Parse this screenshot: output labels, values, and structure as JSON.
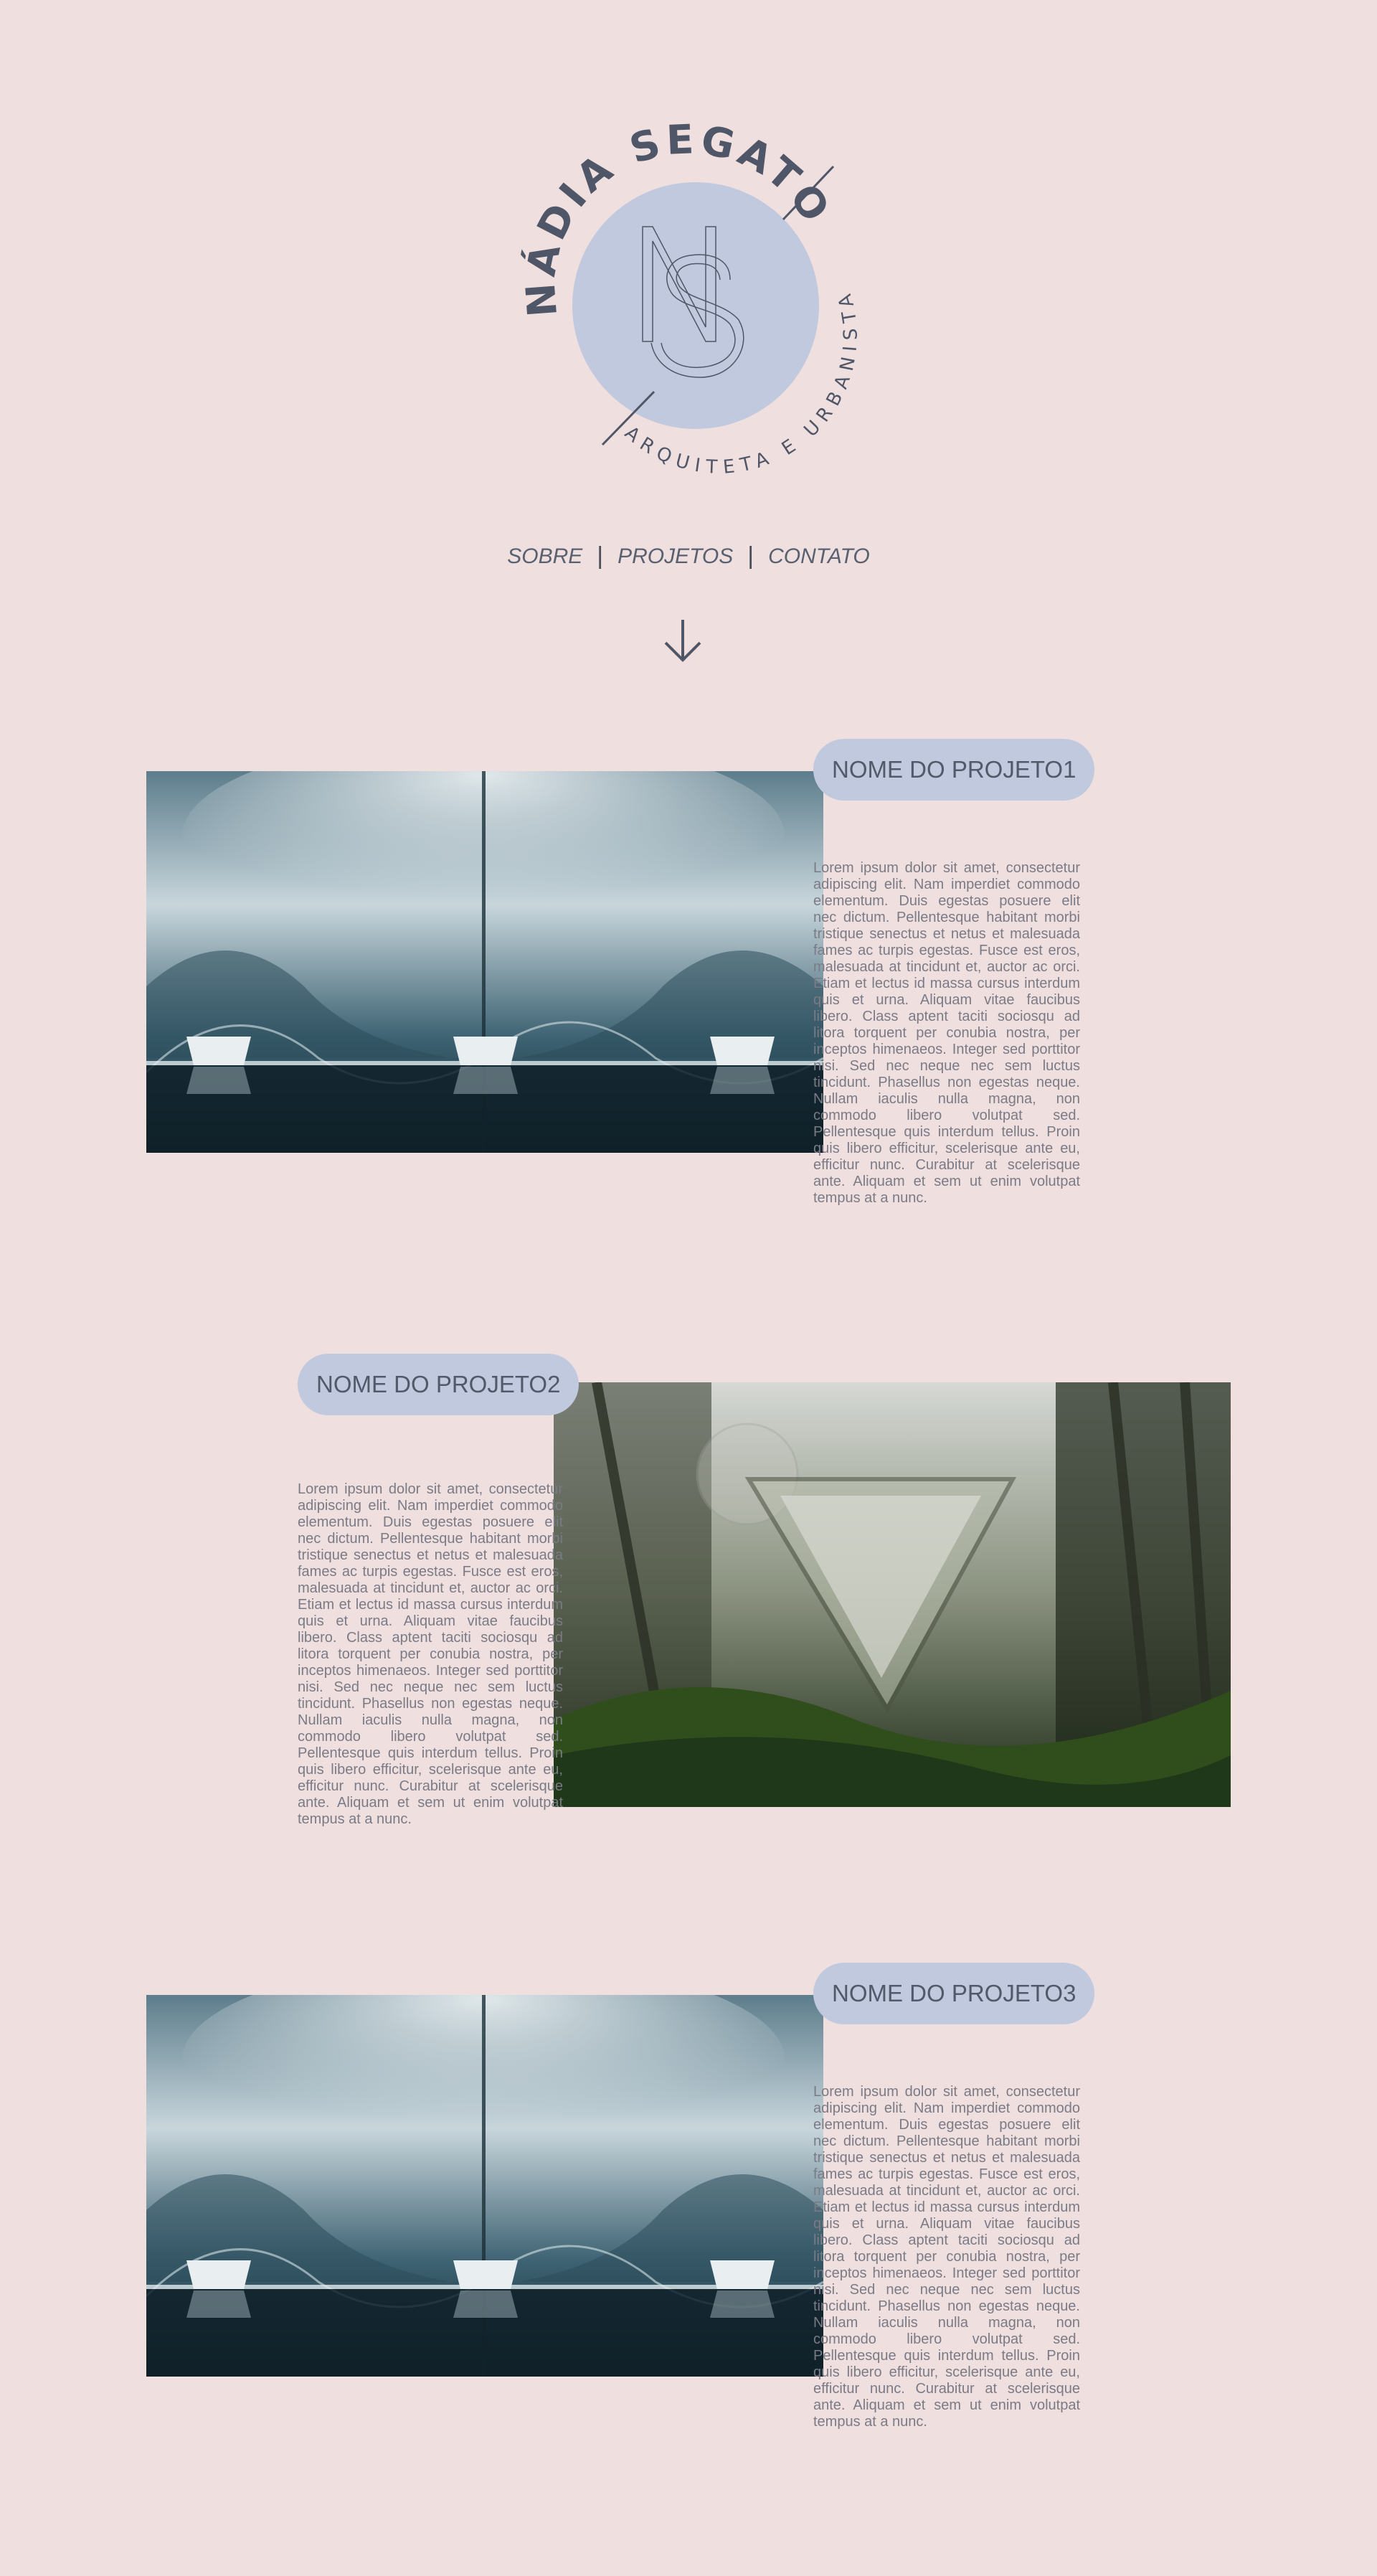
{
  "logo": {
    "name": "NÁDIA SEGATO",
    "subtitle": "ARQUITETA E URBANISTA",
    "monogram": "NS",
    "circle_color": "#c0c9dd",
    "text_color": "#4f5667"
  },
  "nav": {
    "items": [
      "SOBRE",
      "PROJETOS",
      "CONTATO"
    ],
    "separator": "|"
  },
  "scroll_icon": "arrow-down-icon",
  "projects": [
    {
      "title": "NOME DO PROJETO1",
      "image": "concrete-vault-architecture-photo",
      "description": "Lorem ipsum dolor sit amet, consectetur adipiscing elit. Nam imperdiet commodo elementum. Duis egestas posuere elit nec dictum. Pellentesque habitant morbi tristique senectus et netus et malesuada fames ac turpis egestas. Fusce est eros, malesuada at tincidunt et, auctor ac orci. Etiam et lectus id massa cursus interdum quis et urna. Aliquam vitae faucibus libero. Class aptent taciti sociosqu ad litora torquent per conubia nostra, per inceptos himenaeos. Integer sed porttitor nisi. Sed nec neque nec sem luctus tincidunt. Phasellus non egestas neque. Nullam iaculis nulla magna, non commodo libero volutpat sed. Pellentesque quis interdum tellus. Proin quis libero efficitur, scelerisque ante eu, efficitur nunc. Curabitur at scelerisque ante. Aliquam et sem ut enim volutpat tempus at a nunc."
    },
    {
      "title": "NOME DO PROJETO2",
      "image": "forest-geometric-sculpture-photo",
      "description": "Lorem ipsum dolor sit amet, consectetur adipiscing elit. Nam imperdiet commodo elementum. Duis egestas posuere elit nec dictum. Pellentesque habitant morbi tristique senectus et netus et malesuada fames ac turpis egestas. Fusce est eros, malesuada at tincidunt et, auctor ac orci. Etiam et lectus id massa cursus interdum quis et urna. Aliquam vitae faucibus libero. Class aptent taciti sociosqu ad litora torquent per conubia nostra, per inceptos himenaeos. Integer sed porttitor nisi. Sed nec neque nec sem luctus tincidunt. Phasellus non egestas neque. Nullam iaculis nulla magna, non commodo libero volutpat sed. Pellentesque quis interdum tellus. Proin quis libero efficitur, scelerisque ante eu, efficitur nunc. Curabitur at scelerisque ante. Aliquam et sem ut enim volutpat tempus at a nunc."
    },
    {
      "title": "NOME DO PROJETO3",
      "image": "concrete-vault-architecture-photo",
      "description": "Lorem ipsum dolor sit amet, consectetur adipiscing elit. Nam imperdiet commodo elementum. Duis egestas posuere elit nec dictum. Pellentesque habitant morbi tristique senectus et netus et malesuada fames ac turpis egestas. Fusce est eros, malesuada at tincidunt et, auctor ac orci. Etiam et lectus id massa cursus interdum quis et urna. Aliquam vitae faucibus libero. Class aptent taciti sociosqu ad litora torquent per conubia nostra, per inceptos himenaeos. Integer sed porttitor nisi. Sed nec neque nec sem luctus tincidunt. Phasellus non egestas neque. Nullam iaculis nulla magna, non commodo libero volutpat sed. Pellentesque quis interdum tellus. Proin quis libero efficitur, scelerisque ante eu, efficitur nunc. Curabitur at scelerisque ante. Aliquam et sem ut enim volutpat tempus at a nunc."
    }
  ],
  "colors": {
    "background": "#efdfdf",
    "pill": "#c0c9dd",
    "text": "#59606f"
  }
}
